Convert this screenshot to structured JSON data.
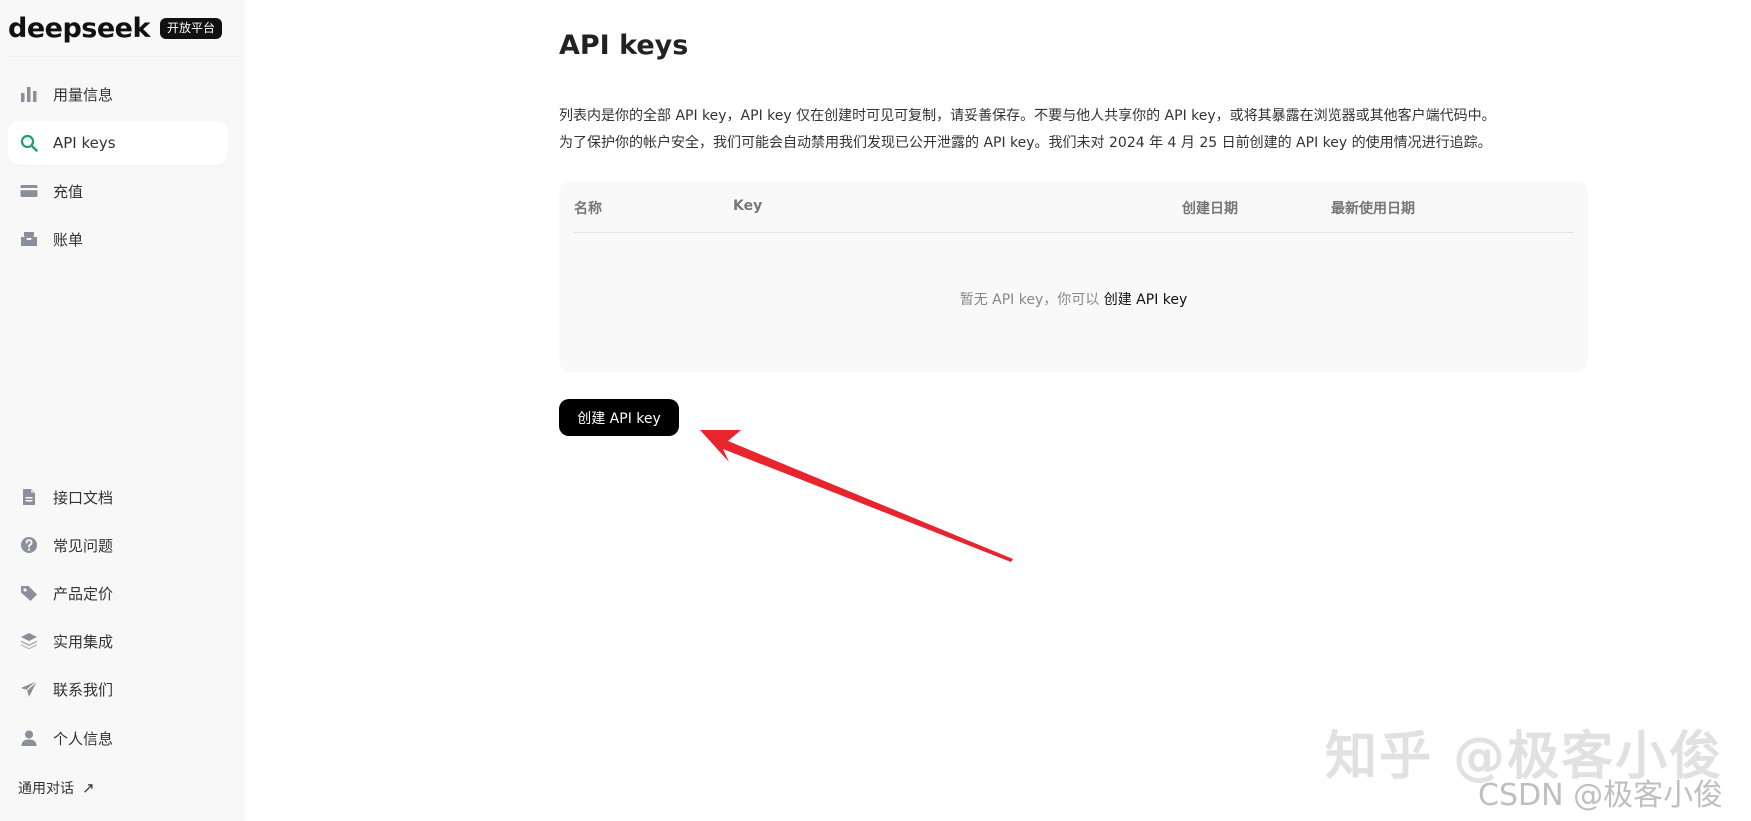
{
  "brand": {
    "logo": "deepseek",
    "badge": "开放平台"
  },
  "sidebar": {
    "top_items": [
      {
        "label": "用量信息",
        "icon": "bar-chart-icon"
      },
      {
        "label": "API keys",
        "icon": "search-icon",
        "active": true
      },
      {
        "label": "充值",
        "icon": "wallet-icon"
      },
      {
        "label": "账单",
        "icon": "inbox-icon"
      }
    ],
    "bottom_items": [
      {
        "label": "接口文档",
        "icon": "document-icon"
      },
      {
        "label": "常见问题",
        "icon": "question-icon"
      },
      {
        "label": "产品定价",
        "icon": "tag-icon"
      },
      {
        "label": "实用集成",
        "icon": "layers-icon"
      },
      {
        "label": "联系我们",
        "icon": "send-icon"
      },
      {
        "label": "个人信息",
        "icon": "user-icon"
      }
    ],
    "footer_link": {
      "label": "通用对话",
      "arrow": "↗"
    }
  },
  "main": {
    "title": "API keys",
    "description_line1": "列表内是你的全部 API key，API key 仅在创建时可见可复制，请妥善保存。不要与他人共享你的 API key，或将其暴露在浏览器或其他客户端代码中。",
    "description_line2": "为了保护你的帐户安全，我们可能会自动禁用我们发现已公开泄露的 API key。我们未对 2024 年 4 月 25 日前创建的 API key 的使用情况进行追踪。",
    "table": {
      "headers": {
        "name": "名称",
        "key": "Key",
        "created": "创建日期",
        "last_used": "最新使用日期"
      },
      "empty_text": "暂无 API key，你可以",
      "empty_link": "创建 API key"
    },
    "create_button": "创建 API key"
  },
  "watermarks": {
    "zhihu": "知乎 @极客小俊",
    "csdn": "CSDN @极客小俊"
  },
  "colors": {
    "accent": "#1aa36a",
    "annotation": "#e8242e",
    "button_bg": "#000000"
  }
}
